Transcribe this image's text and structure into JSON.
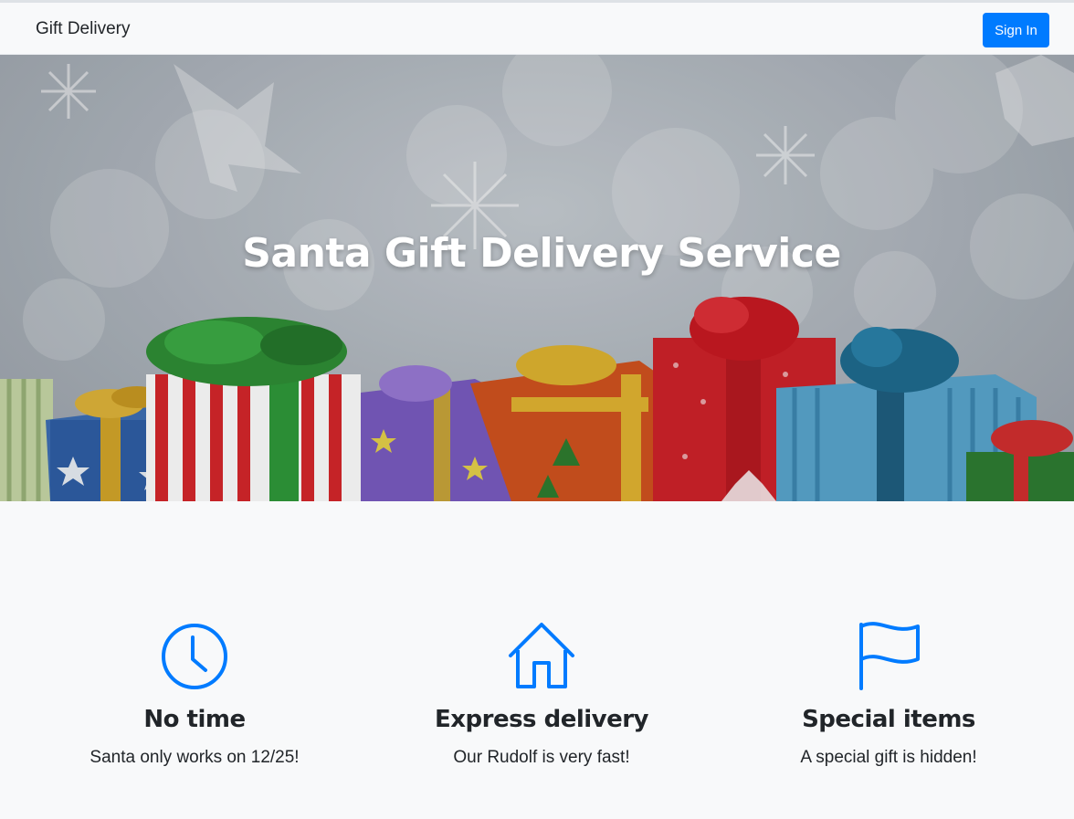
{
  "navbar": {
    "brand": "Gift Delivery",
    "signin_label": "Sign In"
  },
  "hero": {
    "title": "Santa Gift Delivery Service"
  },
  "features": [
    {
      "icon": "clock-icon",
      "title": "No time",
      "text": "Santa only works on 12/25!"
    },
    {
      "icon": "house-icon",
      "title": "Express delivery",
      "text": "Our Rudolf is very fast!"
    },
    {
      "icon": "flag-icon",
      "title": "Special items",
      "text": "A special gift is hidden!"
    }
  ],
  "colors": {
    "accent": "#007bff",
    "background": "#f8f9fa",
    "text": "#212529"
  }
}
